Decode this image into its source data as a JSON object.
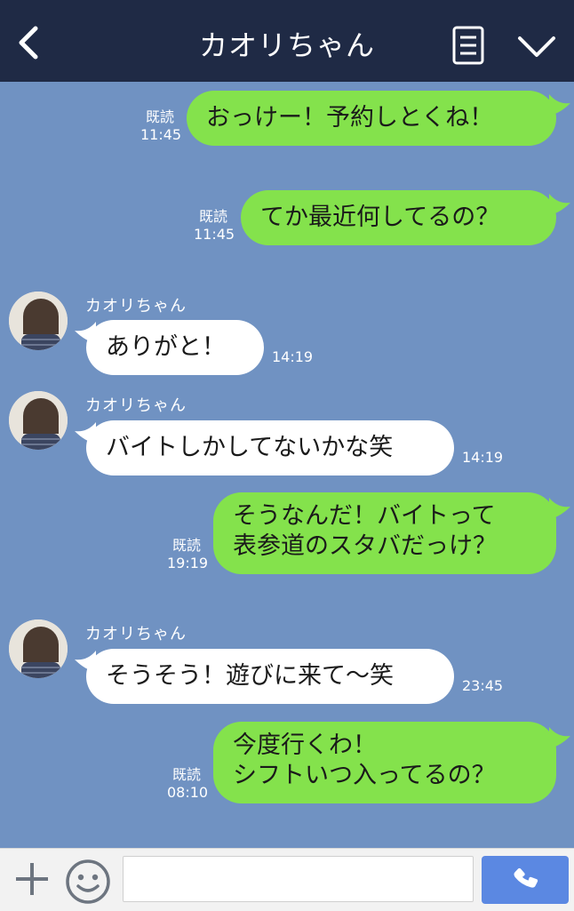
{
  "header": {
    "title": "カオリちゃん",
    "back_icon": "back-arrow-icon",
    "menu_icon": "notes-icon",
    "expand_icon": "chevron-down-icon"
  },
  "messages": [
    {
      "dir": "out",
      "read_label": "既読",
      "time": "11:45",
      "text": "おっけー！予約しとくね！"
    },
    {
      "dir": "out",
      "read_label": "既読",
      "time": "11:45",
      "text": "てか最近何してるの？"
    },
    {
      "dir": "in",
      "sender": "カオリちゃん",
      "time": "14:19",
      "text": "ありがと！"
    },
    {
      "dir": "in",
      "sender": "カオリちゃん",
      "time": "14:19",
      "text": "バイトしかしてないかな笑"
    },
    {
      "dir": "out",
      "read_label": "既読",
      "time": "19:19",
      "lines": [
        "そうなんだ！バイトって",
        "表参道のスタバだっけ？"
      ]
    },
    {
      "dir": "in",
      "sender": "カオリちゃん",
      "time": "23:45",
      "text": "そうそう！遊びに来て〜笑"
    },
    {
      "dir": "out",
      "read_label": "既読",
      "time": "08:10",
      "lines": [
        "今度行くわ！",
        "シフトいつ入ってるの？"
      ]
    }
  ],
  "input": {
    "placeholder": ""
  },
  "colors": {
    "header": "#1f2a45",
    "background": "#7092c2",
    "outgoing": "#84e24c",
    "incoming": "#ffffff",
    "send": "#5b88e2"
  }
}
